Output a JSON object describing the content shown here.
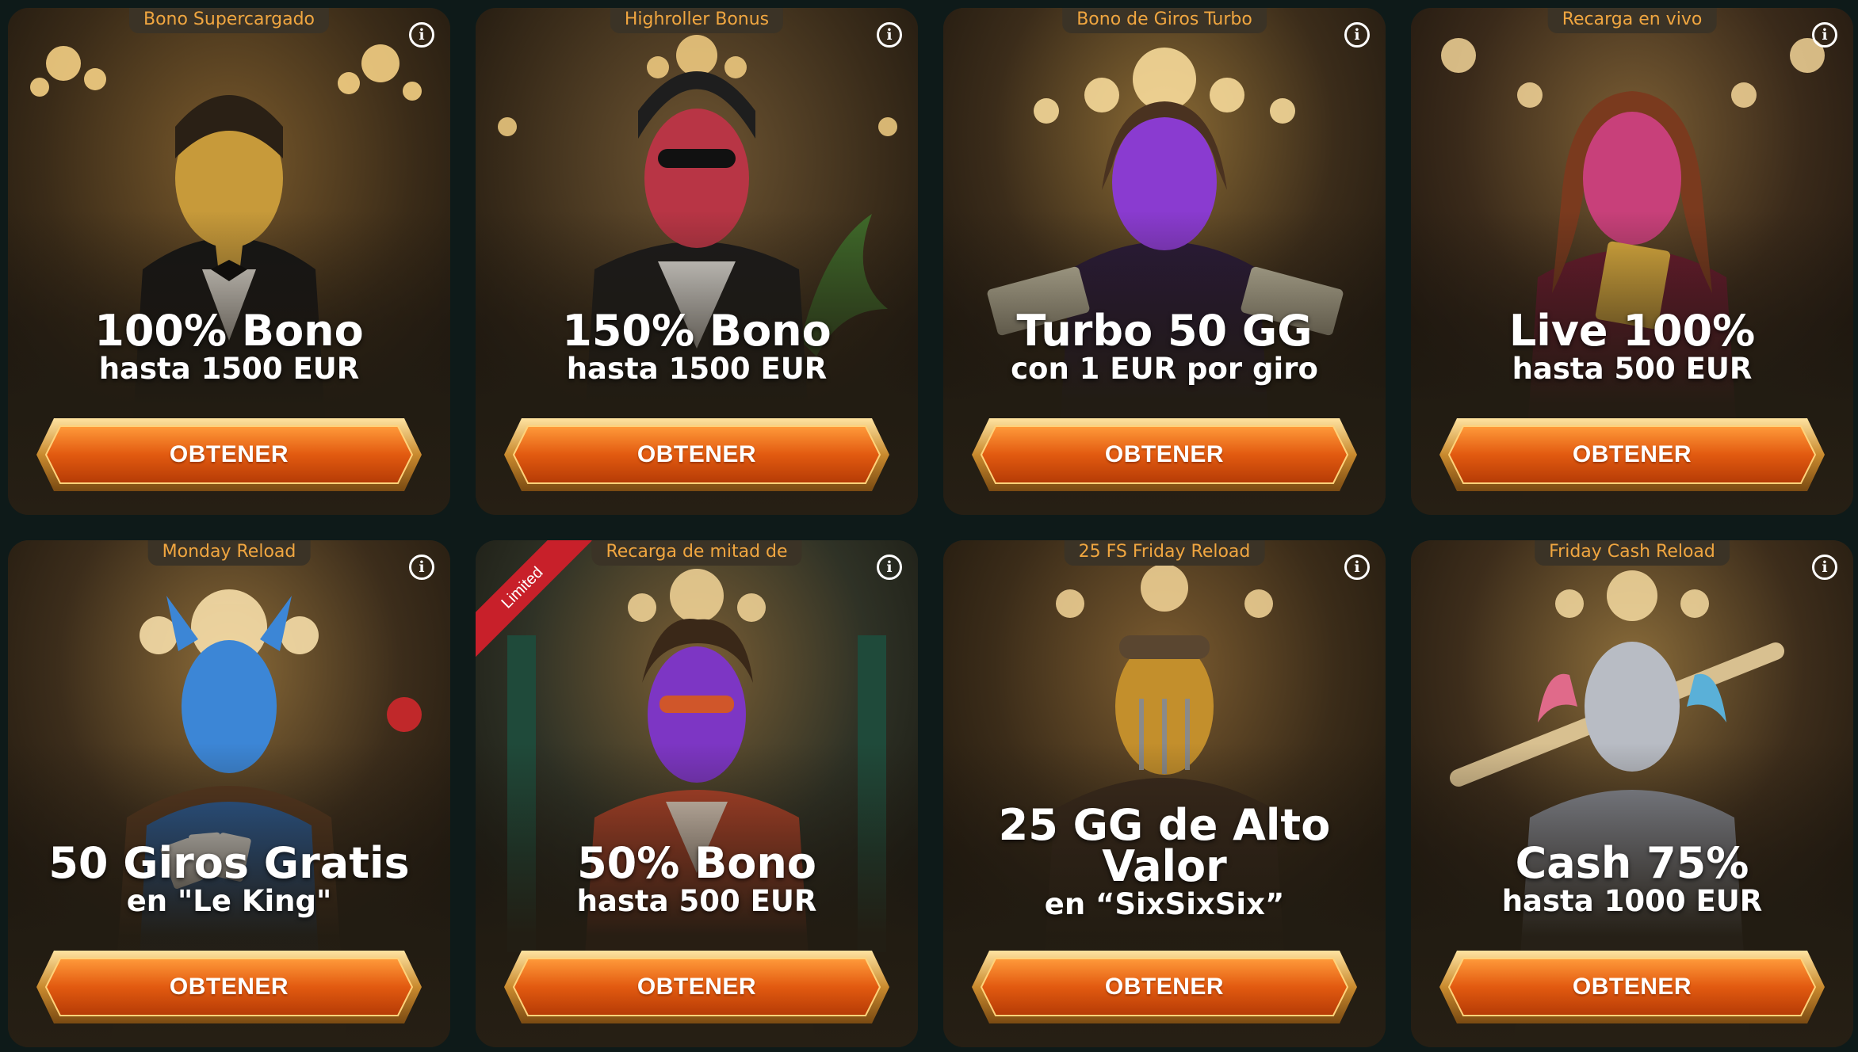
{
  "cards": [
    {
      "tag": "Bono Supercargado",
      "title": "100% Bono",
      "subtitle": "hasta 1500 EUR",
      "button": "OBTENER",
      "character": "golden-masked-gentleman",
      "theme": "#c79a3a"
    },
    {
      "tag": "Highroller Bonus",
      "title": "150% Bono",
      "subtitle": "hasta 1500 EUR",
      "button": "OBTENER",
      "character": "red-crystal-man-beanie",
      "theme": "#c23a44"
    },
    {
      "tag": "Bono de Giros Turbo",
      "title": "Turbo 50 GG",
      "subtitle": "con 1 EUR por giro",
      "button": "OBTENER",
      "character": "purple-crystal-woman",
      "theme": "#8a3bd0"
    },
    {
      "tag": "Recarga en vivo",
      "title": "Live 100%",
      "subtitle": "hasta 500 EUR",
      "button": "OBTENER",
      "character": "pink-crystal-woman",
      "theme": "#c8407a"
    },
    {
      "tag": "Monday Reload",
      "title": "50 Giros Gratis",
      "subtitle": "en \"Le King\"",
      "button": "OBTENER",
      "character": "blue-crystal-king",
      "theme": "#3c86d6"
    },
    {
      "tag": "Recarga de mitad de",
      "title": "50% Bono",
      "subtitle": "hasta 500 EUR",
      "button": "OBTENER",
      "character": "purple-crystal-man-jacket",
      "theme": "#7d36c4",
      "ribbon": "Limited"
    },
    {
      "tag": "25 FS Friday Reload",
      "title": "25 GG de Alto Valor",
      "subtitle": "en “SixSixSix”",
      "button": "OBTENER",
      "character": "golden-masked-aviator",
      "theme": "#c38f2c"
    },
    {
      "tag": "Friday Cash Reload",
      "title": "Cash 75%",
      "subtitle": "hasta 1000 EUR",
      "button": "OBTENER",
      "character": "silver-crystal-woman-bat",
      "theme": "#b8bcc4"
    }
  ]
}
